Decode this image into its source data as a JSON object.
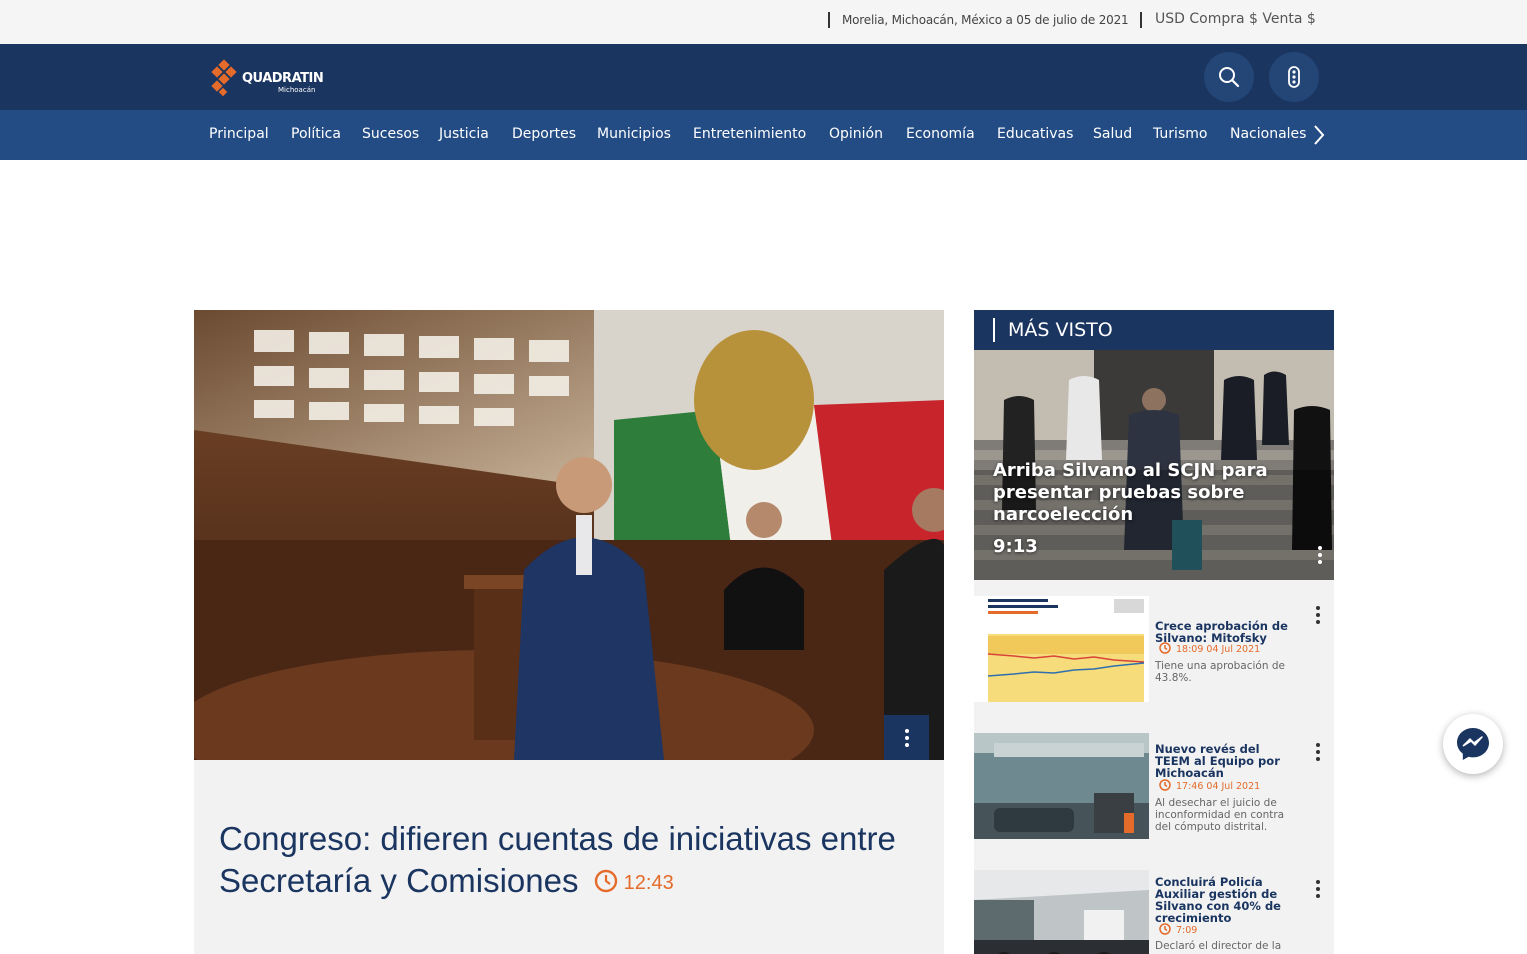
{
  "topbar": {
    "date": "Morelia, Michoacán, México a 05 de julio de 2021",
    "currency": "USD Compra $ Venta $"
  },
  "header": {
    "logo_word": "QUADRATIN",
    "logo_sub": "Michoacán",
    "search_icon": "search-icon",
    "menu_icon": "dots-menu-icon"
  },
  "nav": {
    "items": [
      "Principal",
      "Política",
      "Sucesos",
      "Justicia",
      "Deportes",
      "Municipios",
      "Entretenimiento",
      "Opinión",
      "Economía",
      "Educativas",
      "Salud",
      "Turismo",
      "Nacionales"
    ],
    "more_icon": "chevron-right-icon"
  },
  "feature": {
    "title": "Congreso: difieren cuentas de iniciativas entre Secretaría y Comisiones",
    "time": "12:43"
  },
  "sidebar": {
    "heading": "MÁS VISTO",
    "top": {
      "title": "Arriba Silvano al SCJN para presentar pruebas sobre narcoelección",
      "time": "9:13"
    },
    "items": [
      {
        "title": "Crece aprobación de Silvano: Mitofsky",
        "time": "18:09 04 Jul 2021",
        "desc": "Tiene una aprobación de 43.8%."
      },
      {
        "title": "Nuevo revés del TEEM al Equipo por Michoacán",
        "time": "17:46 04 Jul 2021",
        "desc": "Al desechar el juicio de inconformidad en contra del cómputo distrital."
      },
      {
        "title": "Concluirá Policía Auxiliar gestión de Silvano con 40% de crecimiento",
        "time": "7:09",
        "desc": "Declaró el director de la"
      }
    ]
  },
  "colors": {
    "navy": "#1b3561",
    "nav_blue": "#234c85",
    "accent": "#e46b2a"
  }
}
